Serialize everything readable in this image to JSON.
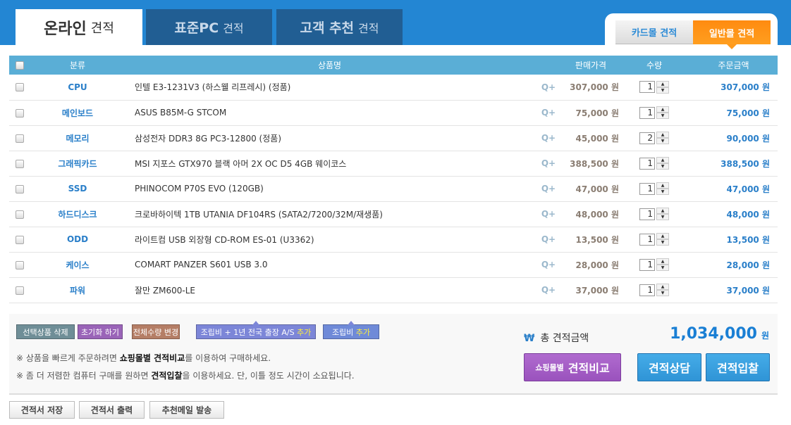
{
  "tabs": [
    {
      "main": "온라인",
      "sub": "견적"
    },
    {
      "main": "표준PC",
      "sub": "견적"
    },
    {
      "main": "고객 추천",
      "sub": "견적"
    }
  ],
  "mall_tabs": {
    "card": "카드몰 견적",
    "general": "일반몰 견적"
  },
  "table": {
    "headers": {
      "category": "분류",
      "product": "상품명",
      "price": "판매가격",
      "qty": "수량",
      "amount": "주문금액"
    },
    "zoom_label": "Q+",
    "rows": [
      {
        "category": "CPU",
        "product": "인텔 E3-1231V3 (하스웰 리프레시) (정품)",
        "price": "307,000 원",
        "qty": "1",
        "amount": "307,000 원"
      },
      {
        "category": "메인보드",
        "product": "ASUS B85M-G STCOM",
        "price": "75,000 원",
        "qty": "1",
        "amount": "75,000 원"
      },
      {
        "category": "메모리",
        "product": "삼성전자 DDR3 8G PC3-12800 (정품)",
        "price": "45,000 원",
        "qty": "2",
        "amount": "90,000 원"
      },
      {
        "category": "그래픽카드",
        "product": "MSI 지포스 GTX970 블랙 아머 2X OC D5 4GB 웨이코스",
        "price": "388,500 원",
        "qty": "1",
        "amount": "388,500 원"
      },
      {
        "category": "SSD",
        "product": "PHINOCOM P70S EVO (120GB)",
        "price": "47,000 원",
        "qty": "1",
        "amount": "47,000 원"
      },
      {
        "category": "하드디스크",
        "product": "크로바하이텍 1TB UTANIA DF104RS (SATA2/7200/32M/재생품)",
        "price": "48,000 원",
        "qty": "1",
        "amount": "48,000 원"
      },
      {
        "category": "ODD",
        "product": "라이트컴 USB 외장형 CD-ROM ES-01 (U3362)",
        "price": "13,500 원",
        "qty": "1",
        "amount": "13,500 원"
      },
      {
        "category": "케이스",
        "product": "COMART PANZER S601 USB 3.0",
        "price": "28,000 원",
        "qty": "1",
        "amount": "28,000 원"
      },
      {
        "category": "파워",
        "product": "잘만 ZM600-LE",
        "price": "37,000 원",
        "qty": "1",
        "amount": "37,000 원"
      }
    ]
  },
  "actions": {
    "delete": "선택상품 삭제",
    "reset": "초기화 하기",
    "change_qty": "전체수량 변경",
    "assembly_as": "조립비 + 1년 전국 출장 A/S ",
    "assembly": "조립비 ",
    "add": "추가"
  },
  "notes": [
    {
      "pre": "※ 상품을 빠르게 주문하려면 ",
      "bold": "쇼핑몰별 견적비교",
      "post": "를 이용하여 구매하세요."
    },
    {
      "pre": "※ 좀 더 저렴한 컴퓨터 구매를 원하면 ",
      "bold": "견적입찰",
      "post": "을 이용하세요. 단, 이틀 정도 시간이 소요됩니다."
    }
  ],
  "summary": {
    "won_symbol": "₩",
    "label": "총 견적금액",
    "total": "1,034,000",
    "unit": "원"
  },
  "buttons": {
    "compare_small": "쇼핑몰별",
    "compare": "견적비교",
    "consult": "견적상담",
    "bid": "견적입찰"
  },
  "footer": {
    "save": "견적서 저장",
    "print": "견적서 출력",
    "mail": "추천메일 발송"
  },
  "colors": {
    "header_blue": "#2386d3",
    "accent_orange": "#ff9a1c",
    "link_blue": "#2a7fc9"
  }
}
